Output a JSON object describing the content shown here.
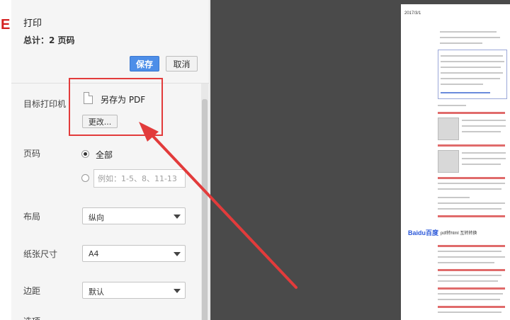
{
  "background": {
    "logo_text": "E"
  },
  "dialog": {
    "title": "打印",
    "total": "总计：2 页码",
    "buttons": {
      "save": "保存",
      "cancel": "取消"
    },
    "destination": {
      "label": "目标打印机",
      "name": "另存为 PDF",
      "change_button": "更改..."
    },
    "pages": {
      "label": "页码",
      "all_option": "全部",
      "custom_placeholder": "例如：1-5、8、11-13"
    },
    "layout": {
      "label": "布局",
      "value": "纵向"
    },
    "paper_size": {
      "label": "纸张尺寸",
      "value": "A4"
    },
    "margins": {
      "label": "边距",
      "value": "默认"
    },
    "options": {
      "label": "选项"
    }
  },
  "preview": {
    "header_text": "2017/3/1",
    "brand": "Baidu百度",
    "brand_sub": "pdf转html 互转转换"
  },
  "colors": {
    "accent_blue": "#4d8ee8",
    "annotation_red": "#e23b3b",
    "preview_background": "#4a4a4a"
  }
}
